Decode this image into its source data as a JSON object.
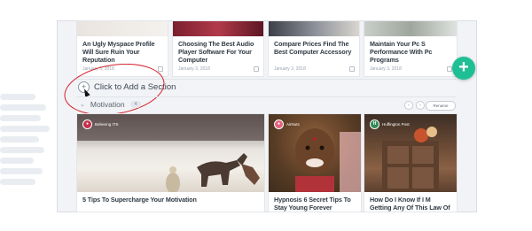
{
  "top_row": {
    "cards": [
      {
        "title": "An Ugly Myspace Profile Will Sure Ruin Your Reputation",
        "date": "January 3, 2018"
      },
      {
        "title": "Choosing The Best Audio Player Software For Your Computer",
        "date": "January 3, 2018"
      },
      {
        "title": "Compare Prices Find The Best Computer Accessory",
        "date": "January 3, 2018"
      },
      {
        "title": "Maintain Your Pc S Performance With Pc Programs",
        "date": "January 3, 2018"
      }
    ]
  },
  "add_section": {
    "label": "Click to Add a Section",
    "icon": "plus-circle-icon"
  },
  "section": {
    "title": "Motivation",
    "count": "4",
    "rename_label": "Rename",
    "prev_icon": "chevron-left-icon",
    "next_icon": "chevron-right-icon",
    "collapse_icon": "chevron-down-icon"
  },
  "fab": {
    "icon": "plus-icon",
    "color": "#1fbf95"
  },
  "motivation_cards": [
    {
      "source": "Believing ITS",
      "title": "5 Tips To Supercharge Your Motivation"
    },
    {
      "source": "AirNuts",
      "title": "Hypnosis 6 Secret Tips To Stay Young Forever"
    },
    {
      "source": "Huffington Post",
      "source_initial": "H",
      "title": "How Do I Know If I M Getting Any Of This Law Of Attraction Stuff"
    }
  ],
  "colors": {
    "highlight_ring": "#d0202a",
    "accent": "#1fbf95"
  }
}
